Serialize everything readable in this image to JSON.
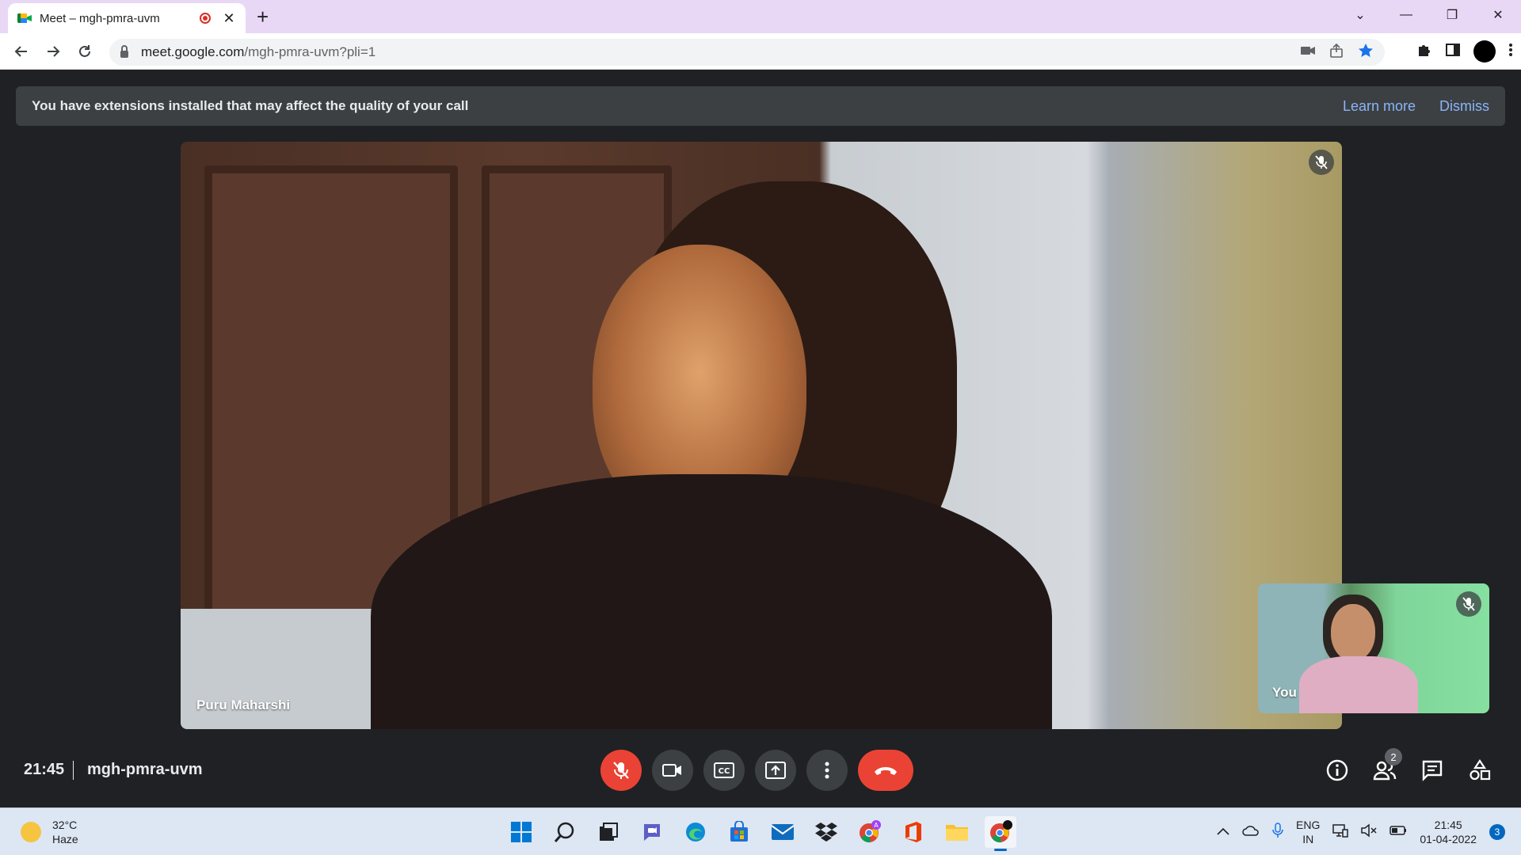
{
  "browser": {
    "tab_title": "Meet – mgh-pmra-uvm",
    "url_host": "meet.google.com",
    "url_path": "/mgh-pmra-uvm?pli=1"
  },
  "banner": {
    "message": "You have extensions installed that may affect the quality of your call",
    "learn_more": "Learn more",
    "dismiss": "Dismiss"
  },
  "main_participant": {
    "name": "Puru Maharshi",
    "muted": true
  },
  "self_view": {
    "label": "You",
    "muted": true
  },
  "meeting": {
    "time": "21:45",
    "code": "mgh-pmra-uvm",
    "participant_count": "2"
  },
  "controls": [
    "mic-off",
    "camera",
    "captions",
    "present",
    "more-options",
    "leave-call"
  ],
  "side_controls": [
    "info",
    "people",
    "chat",
    "activities"
  ],
  "colors": {
    "accent_red": "#ea4335",
    "link_blue": "#8ab4f8",
    "meet_bg": "#202124"
  },
  "taskbar": {
    "temperature": "32°C",
    "condition": "Haze",
    "lang_line1": "ENG",
    "lang_line2": "IN",
    "clock_time": "21:45",
    "clock_date": "01-04-2022",
    "notification_count": "3"
  }
}
